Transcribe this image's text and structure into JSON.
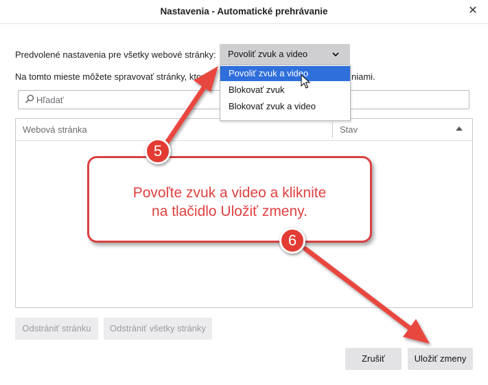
{
  "dialog": {
    "title": "Nastavenia - Automatické prehrávanie",
    "close_glyph": "✕"
  },
  "defaults": {
    "label": "Predvolené nastavenia pre všetky webové stránky:",
    "selected": "Povoliť zvuk a video",
    "chevron_glyph": "⌄",
    "options": [
      "Povoliť zvuk a video",
      "Blokovať zvuk",
      "Blokovať zvuk a video"
    ]
  },
  "manage_text": {
    "visible_start": "Na tomto mieste môžete spravovať stránky, ktoré",
    "visible_end": "niami."
  },
  "search": {
    "placeholder": "Hľadať"
  },
  "table": {
    "columns": [
      "Webová stránka",
      "Stav"
    ],
    "rows": []
  },
  "buttons": {
    "remove_site": "Odstrániť stránku",
    "remove_all": "Odstrániť všetky stránky",
    "cancel": "Zrušiť",
    "save": "Uložiť zmeny"
  },
  "annotations": {
    "badge_5": "5",
    "badge_6": "6",
    "callout_line1": "Povoľte zvuk a video a kliknite",
    "callout_line2": "na tlačidlo Uložiť zmeny.",
    "accent_color": "#e23b33"
  }
}
